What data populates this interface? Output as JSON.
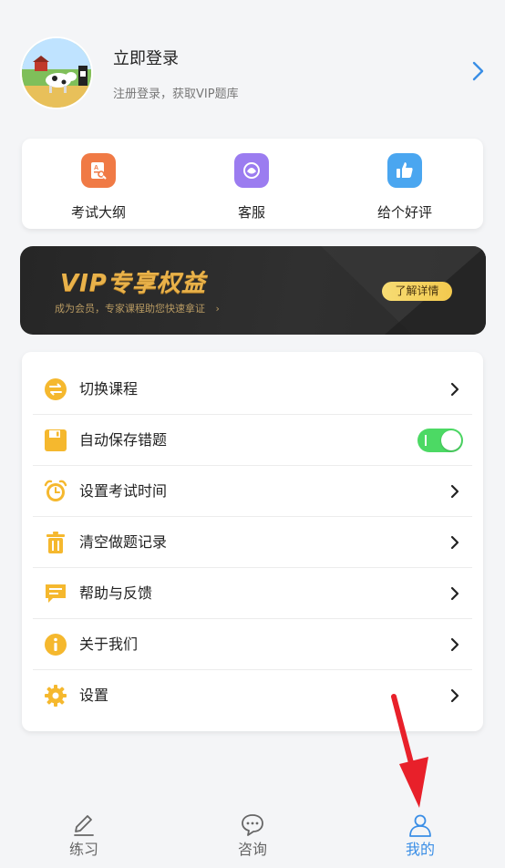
{
  "header": {
    "login_title": "立即登录",
    "login_sub": "注册登录，获取VIP题库"
  },
  "quick": [
    {
      "label": "考试大纲",
      "icon": "syllabus-icon",
      "color": "#f07a45"
    },
    {
      "label": "客服",
      "icon": "customer-service-icon",
      "color": "#9b7cf0"
    },
    {
      "label": "给个好评",
      "icon": "thumbs-up-icon",
      "color": "#4aa6f0"
    }
  ],
  "vip": {
    "title": "VIP专享权益",
    "subtitle": "成为会员，专家课程助您快速拿证",
    "button": "了解详情"
  },
  "menu": [
    {
      "label": "切换课程",
      "icon": "switch-course-icon",
      "control": "chevron"
    },
    {
      "label": "自动保存错题",
      "icon": "save-icon",
      "control": "toggle",
      "toggle_on": true
    },
    {
      "label": "设置考试时间",
      "icon": "alarm-clock-icon",
      "control": "chevron"
    },
    {
      "label": "清空做题记录",
      "icon": "trash-icon",
      "control": "chevron"
    },
    {
      "label": "帮助与反馈",
      "icon": "feedback-icon",
      "control": "chevron"
    },
    {
      "label": "关于我们",
      "icon": "info-icon",
      "control": "chevron"
    },
    {
      "label": "设置",
      "icon": "gear-icon",
      "control": "chevron"
    }
  ],
  "tabs": [
    {
      "label": "练习",
      "icon": "pencil-icon",
      "active": false
    },
    {
      "label": "咨询",
      "icon": "chat-icon",
      "active": false
    },
    {
      "label": "我的",
      "icon": "user-icon",
      "active": true
    }
  ],
  "colors": {
    "accent_yellow": "#f5b82e",
    "active_tab": "#3a8ee6",
    "toggle_on": "#4cd964",
    "annotation": "#e8202a"
  }
}
